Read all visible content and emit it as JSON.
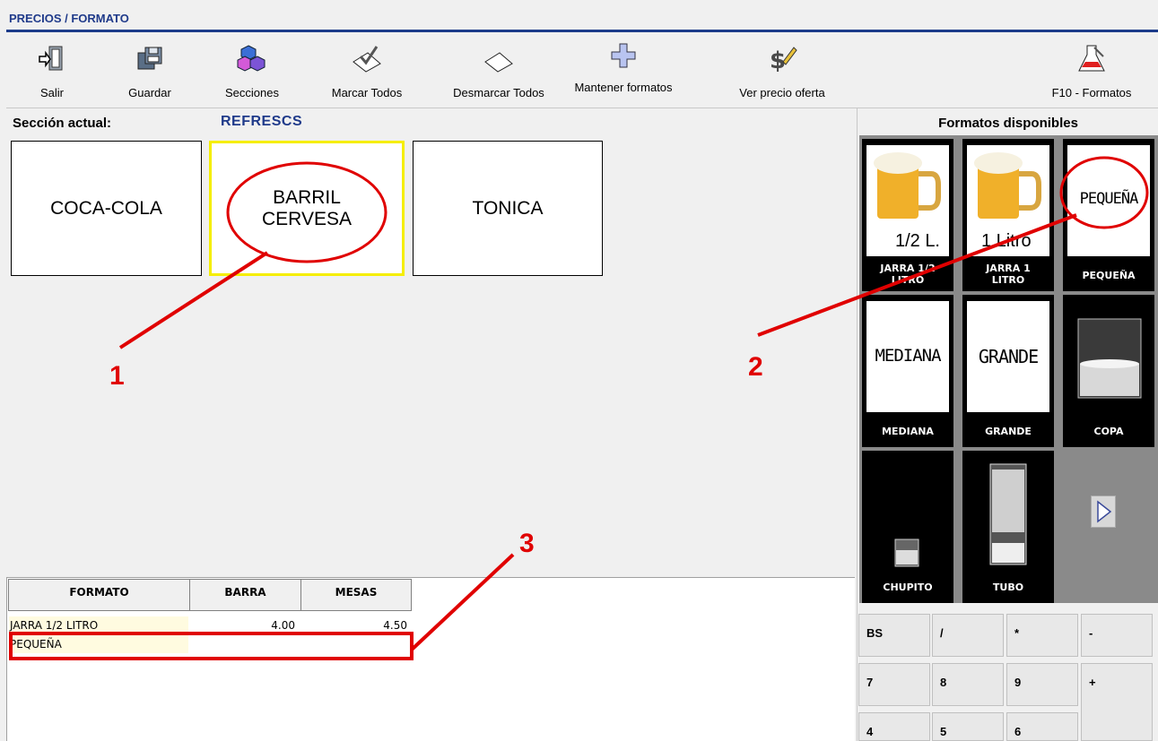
{
  "window": {
    "title": "PRECIOS / FORMATO"
  },
  "toolbar": {
    "salir": "Salir",
    "guardar": "Guardar",
    "secciones": "Secciones",
    "marcar_todos": "Marcar Todos",
    "desmarcar_todos": "Desmarcar Todos",
    "mantener_formatos": "Mantener formatos",
    "ver_precio_oferta": "Ver precio oferta",
    "f10_formatos": "F10 - Formatos"
  },
  "section": {
    "label": "Sección actual:",
    "name": "REFRESCS"
  },
  "products": [
    {
      "line1": "COCA-COLA",
      "line2": ""
    },
    {
      "line1": "BARRIL",
      "line2": "CERVESA"
    },
    {
      "line1": "TONICA",
      "line2": ""
    }
  ],
  "formats_panel": {
    "title": "Formatos disponibles",
    "items": [
      {
        "caption_1": "JARRA 1/2",
        "caption_2": "LITRO",
        "image_text": "1/2 L."
      },
      {
        "caption_1": "JARRA 1",
        "caption_2": "LITRO",
        "image_text": "1 Litro"
      },
      {
        "caption_1": "PEQUEÑA",
        "caption_2": "",
        "image_text": "PEQUEÑA"
      },
      {
        "caption_1": "MEDIANA",
        "caption_2": "",
        "image_text": "MEDIANA"
      },
      {
        "caption_1": "GRANDE",
        "caption_2": "",
        "image_text": "GRANDE"
      },
      {
        "caption_1": "COPA",
        "caption_2": "",
        "image_text": ""
      },
      {
        "caption_1": "CHUPITO",
        "caption_2": "",
        "image_text": ""
      },
      {
        "caption_1": "TUBO",
        "caption_2": "",
        "image_text": ""
      }
    ]
  },
  "grid": {
    "headers": [
      "FORMATO",
      "BARRA",
      "MESAS"
    ],
    "rows": [
      {
        "formato": "JARRA 1/2 LITRO",
        "barra": "4.00",
        "mesas": "4.50"
      },
      {
        "formato": "PEQUEÑA",
        "barra": "",
        "mesas": ""
      }
    ]
  },
  "keypad": {
    "keys": [
      "BS",
      "/",
      "*",
      "-",
      "7",
      "8",
      "9",
      "+",
      "4",
      "5",
      "6"
    ]
  },
  "annotations": {
    "n1": "1",
    "n2": "2",
    "n3": "3"
  },
  "colors": {
    "title_blue": "#1f3a8a",
    "selected_border": "#f5ee00",
    "annotation_red": "#e00000"
  }
}
